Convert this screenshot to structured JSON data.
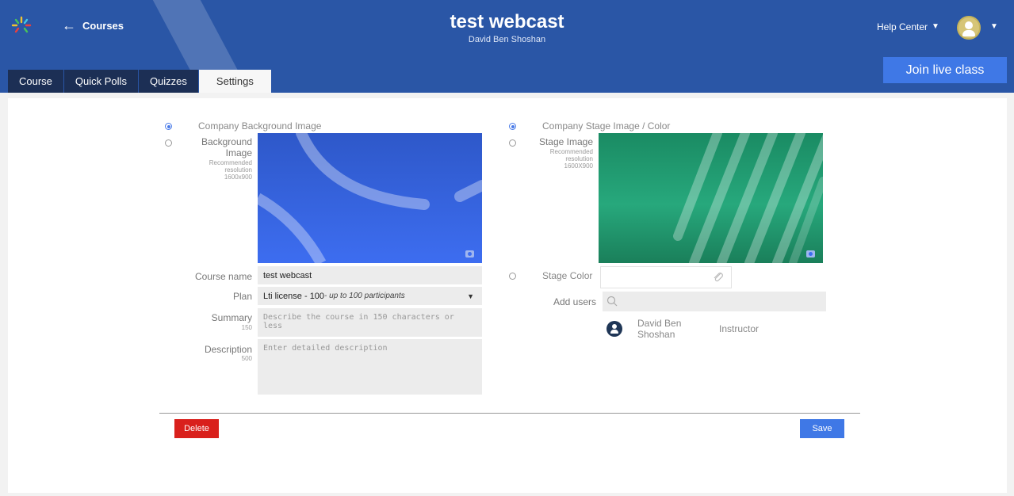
{
  "header": {
    "back_label": "Courses",
    "title": "test webcast",
    "subtitle": "David Ben Shoshan",
    "help_center": "Help Center",
    "join_button": "Join live class"
  },
  "tabs": [
    {
      "label": "Course",
      "active": false
    },
    {
      "label": "Quick Polls",
      "active": false
    },
    {
      "label": "Quizzes",
      "active": false
    },
    {
      "label": "Settings",
      "active": true
    }
  ],
  "settings": {
    "company_bg_label": "Company Background Image",
    "company_bg_selected": true,
    "background_image_label": "Background Image",
    "background_image_hint": "Recommended resolution 1600x900",
    "company_stage_label": "Company Stage Image / Color",
    "company_stage_selected": true,
    "stage_image_label": "Stage Image",
    "stage_image_hint": "Recommended resolution 1600X900",
    "stage_color_label": "Stage Color",
    "course_name_label": "Course name",
    "course_name_value": "test webcast",
    "plan_label": "Plan",
    "plan_value": "Lti license - 100",
    "plan_note": " - up to 100 participants",
    "summary_label": "Summary",
    "summary_limit": "150",
    "summary_placeholder": "Describe the course in  150 characters or less",
    "description_label": "Description",
    "description_limit": "500",
    "description_placeholder": "Enter detailed description",
    "add_users_label": "Add users",
    "users": [
      {
        "name": "David Ben Shoshan",
        "role": "Instructor"
      }
    ]
  },
  "actions": {
    "delete": "Delete",
    "save": "Save"
  },
  "colors": {
    "header_bg": "#2a56a6",
    "tab_bg": "#1c2f55",
    "primary": "#3f78e6",
    "danger": "#d9201c"
  }
}
